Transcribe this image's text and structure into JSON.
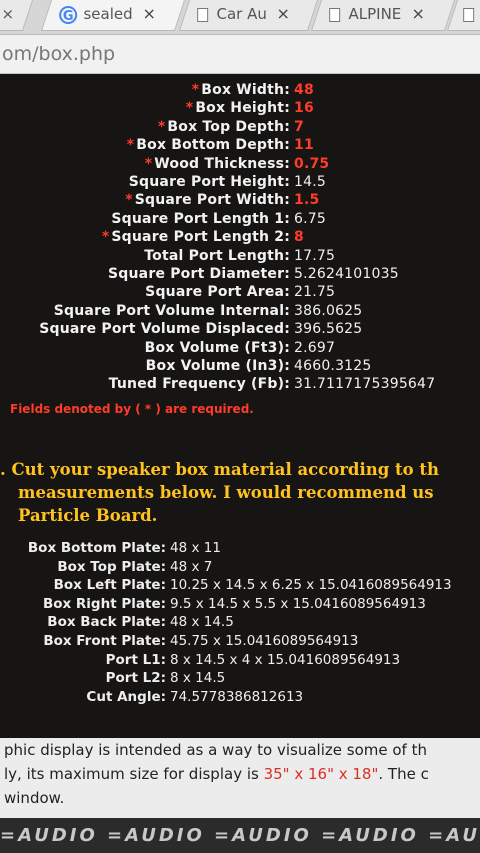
{
  "tabs": [
    {
      "close": "×"
    },
    {
      "icon": "google-icon",
      "title": "sealed",
      "close": "×"
    },
    {
      "icon": "doc-icon",
      "title": "Car Au",
      "close": "×"
    },
    {
      "icon": "doc-icon",
      "title": "ALPINE",
      "close": "×"
    }
  ],
  "url": "om/box.php",
  "fields": [
    {
      "label": "Box Width:",
      "value": "48",
      "required": true
    },
    {
      "label": "Box Height:",
      "value": "16",
      "required": true
    },
    {
      "label": "Box Top Depth:",
      "value": "7",
      "required": true
    },
    {
      "label": "Box Bottom Depth:",
      "value": "11",
      "required": true
    },
    {
      "label": "Wood Thickness:",
      "value": "0.75",
      "required": true
    },
    {
      "label": "Square Port Height:",
      "value": "14.5",
      "required": false
    },
    {
      "label": "Square Port Width:",
      "value": "1.5",
      "required": true
    },
    {
      "label": "Square Port Length 1:",
      "value": "6.75",
      "required": false
    },
    {
      "label": "Square Port Length 2:",
      "value": "8",
      "required": true
    },
    {
      "label": "Total Port Length:",
      "value": "17.75",
      "required": false
    },
    {
      "label": "Square Port Diameter:",
      "value": "5.2624101035",
      "required": false
    },
    {
      "label": "Square Port Area:",
      "value": "21.75",
      "required": false
    },
    {
      "label": "Square Port Volume Internal:",
      "value": "386.0625",
      "required": false
    },
    {
      "label": "Square Port Volume Displaced:",
      "value": "396.5625",
      "required": false
    },
    {
      "label": "Box Volume (Ft3):",
      "value": "2.697",
      "required": false
    },
    {
      "label": "Box Volume (In3):",
      "value": "4660.3125",
      "required": false
    },
    {
      "label": "Tuned Frequency (Fb):",
      "value": "31.7117175395647",
      "required": false
    }
  ],
  "required_note": "Fields denoted by ( * ) are required.",
  "step2": {
    "line1": ". Cut your speaker box material according to th",
    "line2": "measurements below.  I would recommend us",
    "line3": "Particle Board."
  },
  "plates": [
    {
      "label": "Box Bottom Plate:",
      "value": "48 x 11"
    },
    {
      "label": "Box Top Plate:",
      "value": "48 x 7"
    },
    {
      "label": "Box Left Plate:",
      "value": "10.25 x 14.5 x 6.25 x 15.0416089564913"
    },
    {
      "label": "Box Right Plate:",
      "value": "9.5 x 14.5 x 5.5 x 15.0416089564913"
    },
    {
      "label": "Box Back Plate:",
      "value": "48 x 14.5"
    },
    {
      "label": "Box Front Plate:",
      "value": "45.75 x 15.0416089564913"
    },
    {
      "label": "Port L1:",
      "value": "8 x 14.5 x 4 x 15.0416089564913"
    },
    {
      "label": "Port L2:",
      "value": "8 x 14.5"
    },
    {
      "label": "Cut Angle:",
      "value": "74.5778386812613"
    }
  ],
  "footer": {
    "line1": "phic display is intended as a way to visualize some of th",
    "line2_pre": "ly, its maximum size for display is ",
    "line2_hl": "35\" x 16\" x 18\"",
    "line2_post": ". The c",
    "line3": "window."
  },
  "brand_strip": "=AUDIO  =AUDIO  =AUDIO  =AUDIO  =AU",
  "colors": {
    "required": "#ff3b2a",
    "step_heading": "#ffc21f",
    "page_bg": "#171513"
  }
}
